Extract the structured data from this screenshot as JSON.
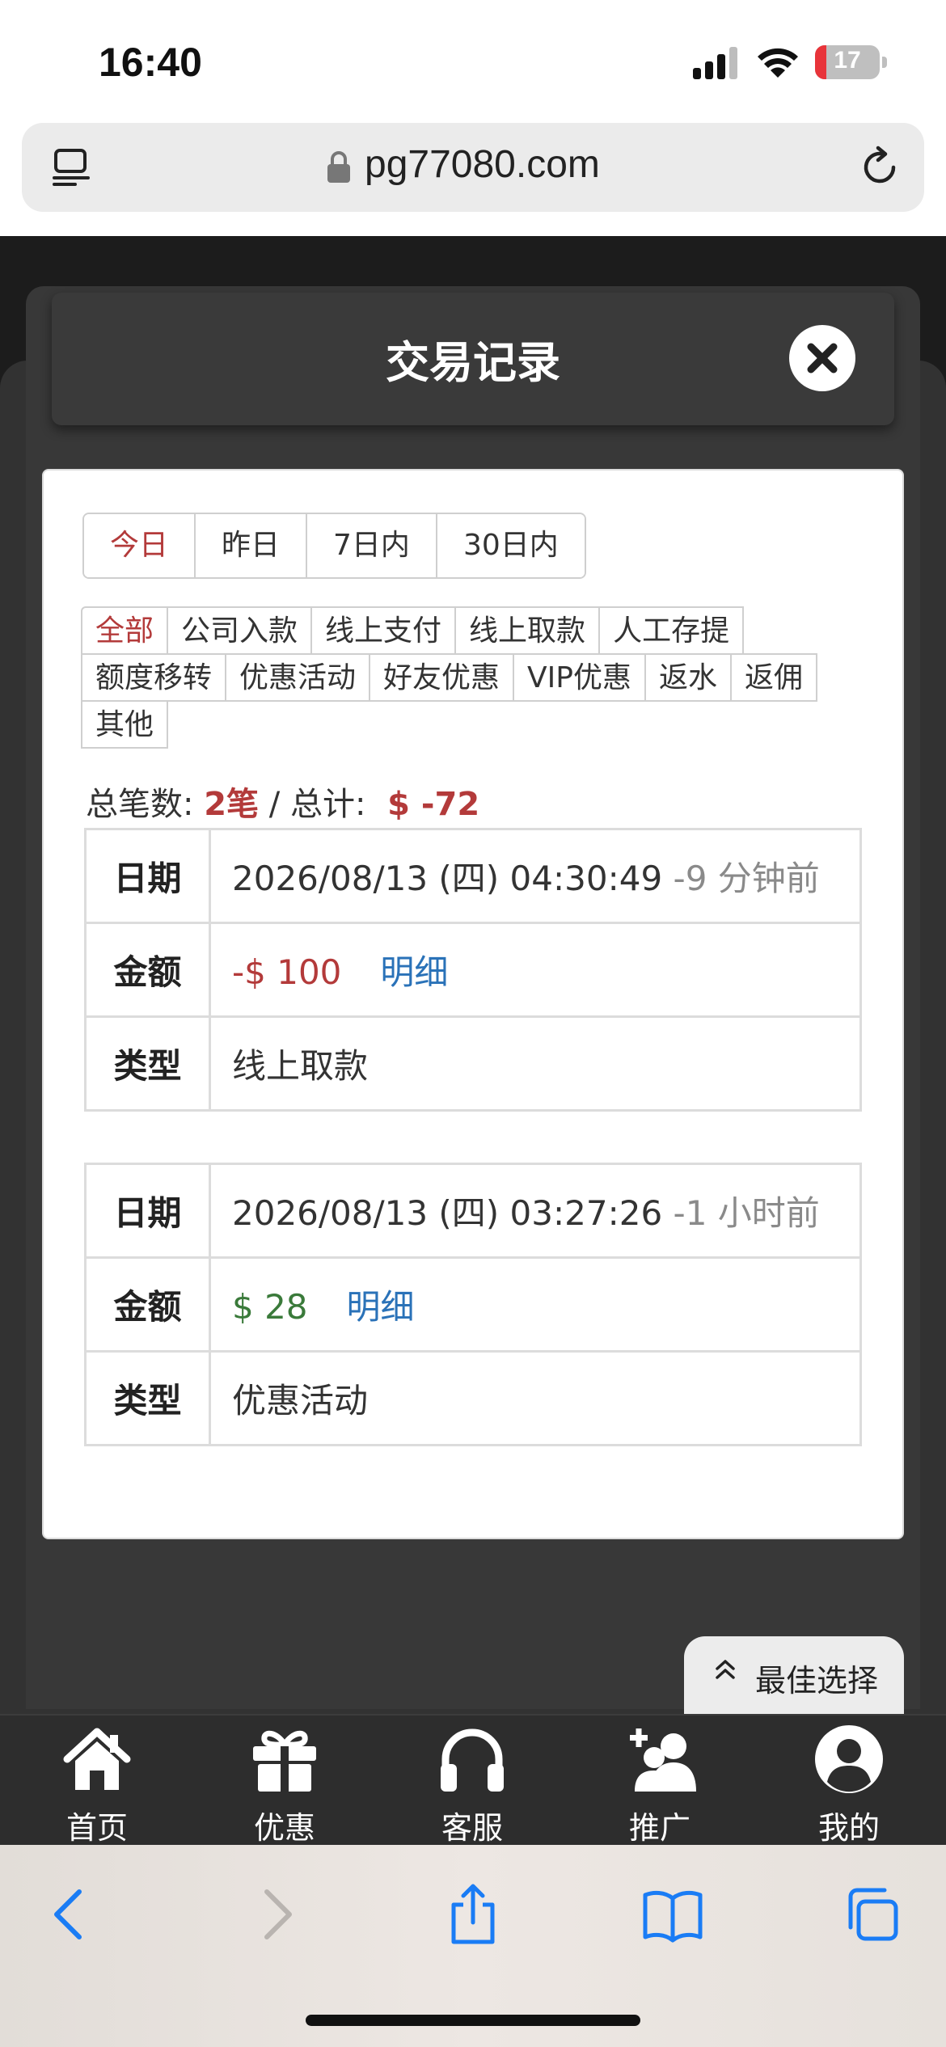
{
  "status_bar": {
    "time": "16:40",
    "battery": "17"
  },
  "url_bar": {
    "url": "pg77080.com"
  },
  "modal": {
    "title": "交易记录"
  },
  "date_tabs": [
    {
      "label": "今日",
      "active": true
    },
    {
      "label": "昨日",
      "active": false
    },
    {
      "label": "7日内",
      "active": false
    },
    {
      "label": "30日内",
      "active": false
    }
  ],
  "type_filters": [
    [
      "全部",
      "公司入款",
      "线上支付",
      "线上取款",
      "人工存提"
    ],
    [
      "额度移转",
      "优惠活动",
      "好友优惠",
      "VIP优惠",
      "返水",
      "返佣"
    ],
    [
      "其他"
    ]
  ],
  "summary": {
    "count_label": "总笔数:",
    "count_value": "2笔",
    "separator": " / ",
    "total_label": "总计:",
    "total_value": "$ -72"
  },
  "labels": {
    "date": "日期",
    "amount": "金额",
    "type": "类型",
    "detail": "明细"
  },
  "records": [
    {
      "date": "2026/08/13 (四) 04:30:49",
      "ago": "-9 分钟前",
      "amount": "-$ 100",
      "amount_sign": "negative",
      "type": "线上取款"
    },
    {
      "date": "2026/08/13 (四) 03:27:26",
      "ago": "-1 小时前",
      "amount": "$ 28",
      "amount_sign": "positive",
      "type": "优惠活动"
    }
  ],
  "best_choice": "最佳选择",
  "bottom_nav": [
    {
      "label": "首页",
      "icon": "home-icon"
    },
    {
      "label": "优惠",
      "icon": "gift-icon"
    },
    {
      "label": "客服",
      "icon": "headset-icon"
    },
    {
      "label": "推广",
      "icon": "add-user-icon"
    },
    {
      "label": "我的",
      "icon": "user-circle-icon"
    }
  ],
  "colors": {
    "accent_red": "#b33a3a",
    "positive_green": "#3a7a3a",
    "link_blue": "#2a72b8",
    "ios_blue": "#1a7cf5"
  }
}
